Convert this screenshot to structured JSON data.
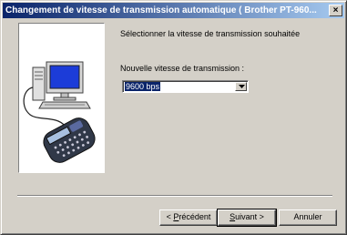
{
  "window": {
    "title": "Changement de vitesse de transmission automatique  ( Brother PT-960...",
    "close_glyph": "×"
  },
  "content": {
    "instruction": "Sélectionner la vitesse de transmission souhaitée",
    "speed_label": "Nouvelle vitesse de transmission :",
    "speed_select": {
      "selected": "9600 bps"
    }
  },
  "buttons": {
    "previous": {
      "mnemonic": "P",
      "rest": "récédent",
      "prefix": "< "
    },
    "next": {
      "mnemonic": "S",
      "rest": "uivant >"
    },
    "cancel": "Annuler"
  },
  "icons": {
    "illustration": "computer-connected-to-label-printer"
  }
}
